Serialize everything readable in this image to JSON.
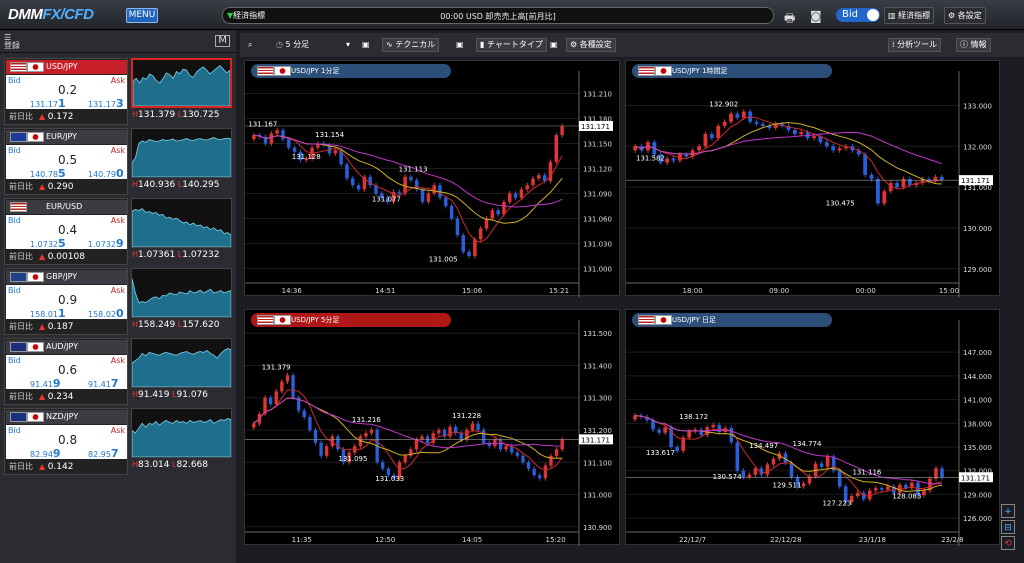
{
  "topbar": {
    "logo_a": "DMM",
    "logo_b": "FX/CFD",
    "menu": "MENU",
    "ticker_tag": "経済指標",
    "ticker_msg": "00:00 USD 卸売売上高[前月比]",
    "bid": "Bid",
    "econ_btn": "経済指標",
    "settings_btn": "各設定"
  },
  "sidebar": {
    "register": "登録",
    "prev_label": "前日比",
    "pairs": [
      {
        "name": "USD/JPY",
        "flags": [
          "us",
          "jp"
        ],
        "spread": "0.2",
        "bid_a": "131.17",
        "bid_b": "1",
        "ask_a": "131.17",
        "ask_b": "3",
        "change": "0.172",
        "high": "131.379",
        "low": "130.725",
        "dir": "up",
        "spark": [
          0.55,
          0.6,
          0.5,
          0.62,
          0.58,
          0.7,
          0.65,
          0.55,
          0.5,
          0.6,
          0.72,
          0.68,
          0.6,
          0.75,
          0.7,
          0.8,
          0.78,
          0.66,
          0.62,
          0.74,
          0.8,
          0.85,
          0.78,
          0.7,
          0.76,
          0.82,
          0.88,
          0.8,
          0.72,
          0.78
        ]
      },
      {
        "name": "EUR/JPY",
        "flags": [
          "eu",
          "jp"
        ],
        "spread": "0.5",
        "bid_a": "140.78",
        "bid_b": "5",
        "ask_a": "140.79",
        "ask_b": "0",
        "change": "0.290",
        "high": "140.936",
        "low": "140.295",
        "dir": "up",
        "spark": [
          0.3,
          0.4,
          0.7,
          0.75,
          0.72,
          0.78,
          0.76,
          0.74,
          0.75,
          0.78,
          0.76,
          0.77,
          0.79,
          0.75,
          0.76,
          0.78,
          0.8,
          0.77,
          0.76,
          0.79,
          0.8,
          0.78,
          0.77,
          0.8,
          0.82,
          0.79,
          0.78,
          0.8,
          0.81,
          0.79
        ]
      },
      {
        "name": "EUR/USD",
        "flags": [
          "eu",
          "us"
        ],
        "spread": "0.4",
        "bid_a": "1.0732",
        "bid_b": "5",
        "ask_a": "1.0732",
        "ask_b": "9",
        "change": "0.00108",
        "high": "1.07361",
        "low": "1.07232",
        "dir": "up",
        "spark": [
          0.75,
          0.78,
          0.76,
          0.8,
          0.72,
          0.74,
          0.7,
          0.72,
          0.66,
          0.68,
          0.6,
          0.62,
          0.58,
          0.6,
          0.55,
          0.5,
          0.52,
          0.46,
          0.5,
          0.44,
          0.46,
          0.4,
          0.42,
          0.36,
          0.4,
          0.34,
          0.36,
          0.28,
          0.3,
          0.25
        ]
      },
      {
        "name": "GBP/JPY",
        "flags": [
          "gb",
          "jp"
        ],
        "spread": "0.9",
        "bid_a": "158.01",
        "bid_b": "1",
        "ask_a": "158.02",
        "ask_b": "0",
        "change": "0.187",
        "high": "158.249",
        "low": "157.620",
        "dir": "up",
        "spark": [
          0.8,
          0.5,
          0.3,
          0.32,
          0.3,
          0.35,
          0.4,
          0.42,
          0.38,
          0.45,
          0.44,
          0.5,
          0.48,
          0.46,
          0.52,
          0.5,
          0.48,
          0.55,
          0.5,
          0.52,
          0.56,
          0.5,
          0.54,
          0.58,
          0.5,
          0.52,
          0.55,
          0.5,
          0.53,
          0.55
        ]
      },
      {
        "name": "AUD/JPY",
        "flags": [
          "au",
          "jp"
        ],
        "spread": "0.6",
        "bid_a": "91.41",
        "bid_b": "9",
        "ask_a": "91.41",
        "ask_b": "7",
        "change": "0.234",
        "high": "91.419",
        "low": "91.076",
        "dir": "up",
        "spark": [
          0.5,
          0.55,
          0.6,
          0.7,
          0.65,
          0.72,
          0.7,
          0.68,
          0.66,
          0.7,
          0.72,
          0.7,
          0.68,
          0.66,
          0.7,
          0.72,
          0.74,
          0.7,
          0.68,
          0.72,
          0.74,
          0.72,
          0.76,
          0.7,
          0.66,
          0.6,
          0.7,
          0.76,
          0.8,
          0.78
        ]
      },
      {
        "name": "NZD/JPY",
        "flags": [
          "nz",
          "jp"
        ],
        "spread": "0.8",
        "bid_a": "82.94",
        "bid_b": "9",
        "ask_a": "82.95",
        "ask_b": "7",
        "change": "0.142",
        "high": "83.014",
        "low": "82.668",
        "dir": "up",
        "spark": [
          0.55,
          0.5,
          0.6,
          0.7,
          0.62,
          0.7,
          0.68,
          0.74,
          0.66,
          0.72,
          0.76,
          0.72,
          0.7,
          0.76,
          0.72,
          0.74,
          0.7,
          0.76,
          0.72,
          0.74,
          0.76,
          0.72,
          0.74,
          0.78,
          0.7,
          0.74,
          0.78,
          0.76,
          0.8,
          0.78
        ]
      }
    ]
  },
  "toolbar": {
    "period": "5 分足",
    "technical": "テクニカル",
    "chart_type": "チャートタイプ",
    "settings": "各種設定",
    "analysis": "分析ツール",
    "info": "情報"
  },
  "colors": {
    "up": "#e03535",
    "down": "#2a5fd8",
    "ma_fast": "#cc2b2b",
    "ma_mid": "#d1b020",
    "ma_slow": "#c038c8",
    "accent": "#2166c8"
  },
  "chart_data": [
    {
      "type": "candlestick",
      "title": "USD/JPY 1分足",
      "ylim": [
        130.985,
        131.225
      ],
      "yticks": [
        "131.210",
        "131.180",
        "131.150",
        "131.120",
        "131.090",
        "131.060",
        "131.030",
        "131.000"
      ],
      "yvals": [
        131.21,
        131.18,
        131.15,
        131.12,
        131.09,
        131.06,
        131.03,
        131.0
      ],
      "xticks": [
        "14:36",
        "14:51",
        "15:06",
        "15:21"
      ],
      "xpos": [
        0.14,
        0.42,
        0.68,
        0.94
      ],
      "current": "131.171",
      "current_val": 131.171,
      "annotations": [
        {
          "t": "131.167",
          "x": 0.01,
          "v": 131.167
        },
        {
          "t": "131.154",
          "x": 0.21,
          "v": 131.154
        },
        {
          "t": "131.128",
          "x": 0.14,
          "v": 131.128
        },
        {
          "t": "131.113",
          "x": 0.46,
          "v": 131.113
        },
        {
          "t": "131.077",
          "x": 0.38,
          "v": 131.077
        },
        {
          "t": "131.005",
          "x": 0.55,
          "v": 131.005
        }
      ],
      "closes": [
        131.16,
        131.158,
        131.15,
        131.162,
        131.166,
        131.155,
        131.145,
        131.14,
        131.13,
        131.132,
        131.145,
        131.15,
        131.148,
        131.138,
        131.142,
        131.125,
        131.108,
        131.1,
        131.095,
        131.11,
        131.1,
        131.09,
        131.085,
        131.08,
        131.092,
        131.09,
        131.11,
        131.106,
        131.095,
        131.08,
        131.09,
        131.1,
        131.085,
        131.075,
        131.06,
        131.04,
        131.02,
        131.015,
        131.035,
        131.048,
        131.06,
        131.07,
        131.065,
        131.08,
        131.09,
        131.085,
        131.095,
        131.1,
        131.108,
        131.112,
        131.105,
        131.128,
        131.16,
        131.171
      ]
    },
    {
      "type": "candlestick",
      "title": "USD/JPY 1時間足",
      "ylim": [
        128.7,
        133.6
      ],
      "yticks": [
        "133.000",
        "132.000",
        "131.000",
        "130.000",
        "129.000"
      ],
      "yvals": [
        133,
        132,
        131,
        130,
        129
      ],
      "xticks": [
        "18:00",
        "09:00",
        "00:00",
        "15:00"
      ],
      "xpos": [
        0.2,
        0.46,
        0.72,
        0.97
      ],
      "current": "131.171",
      "current_val": 131.171,
      "annotations": [
        {
          "t": "132.902",
          "x": 0.25,
          "v": 132.902
        },
        {
          "t": "131.582",
          "x": 0.03,
          "v": 131.582
        },
        {
          "t": "130.475",
          "x": 0.6,
          "v": 130.475
        }
      ],
      "closes": [
        132.0,
        131.9,
        132.1,
        131.8,
        131.6,
        131.7,
        131.65,
        131.8,
        131.75,
        131.9,
        132.0,
        132.3,
        132.2,
        132.5,
        132.6,
        132.8,
        132.7,
        132.85,
        132.6,
        132.55,
        132.5,
        132.45,
        132.55,
        132.5,
        132.4,
        132.3,
        132.35,
        132.2,
        132.25,
        132.1,
        132.0,
        131.9,
        131.95,
        132.0,
        131.9,
        131.8,
        131.3,
        131.2,
        130.6,
        130.9,
        131.1,
        131.0,
        131.2,
        131.05,
        131.1,
        131.2,
        131.15,
        131.25,
        131.17
      ]
    },
    {
      "type": "candlestick",
      "title": "USD/JPY 5分足",
      "ylim": [
        130.89,
        131.51
      ],
      "yticks": [
        "131.500",
        "131.400",
        "131.300",
        "131.200",
        "131.100",
        "131.000",
        "130.900"
      ],
      "yvals": [
        131.5,
        131.4,
        131.3,
        131.2,
        131.1,
        131.0,
        130.9
      ],
      "xticks": [
        "11:35",
        "12:50",
        "14:05",
        "15:20"
      ],
      "xpos": [
        0.17,
        0.42,
        0.68,
        0.93
      ],
      "current": "131.171",
      "current_val": 131.171,
      "annotations": [
        {
          "t": "131.379",
          "x": 0.05,
          "v": 131.379
        },
        {
          "t": "131.216",
          "x": 0.32,
          "v": 131.216
        },
        {
          "t": "131.228",
          "x": 0.62,
          "v": 131.228
        },
        {
          "t": "131.095",
          "x": 0.28,
          "v": 131.095
        },
        {
          "t": "131.033",
          "x": 0.39,
          "v": 131.033
        }
      ],
      "closes": [
        131.22,
        131.25,
        131.3,
        131.28,
        131.32,
        131.35,
        131.37,
        131.3,
        131.26,
        131.24,
        131.2,
        131.16,
        131.12,
        131.15,
        131.18,
        131.14,
        131.1,
        131.13,
        131.15,
        131.18,
        131.19,
        131.2,
        131.1,
        131.08,
        131.06,
        131.05,
        131.1,
        131.12,
        131.14,
        131.17,
        131.18,
        131.16,
        131.19,
        131.2,
        131.18,
        131.21,
        131.19,
        131.17,
        131.2,
        131.22,
        131.2,
        131.16,
        131.15,
        131.17,
        131.14,
        131.15,
        131.13,
        131.12,
        131.1,
        131.08,
        131.06,
        131.05,
        131.09,
        131.12,
        131.14,
        131.17
      ]
    },
    {
      "type": "candlestick",
      "title": "USD/JPY 日足",
      "ylim": [
        124.5,
        149.8
      ],
      "yticks": [
        "147.000",
        "144.000",
        "141.000",
        "138.000",
        "135.000",
        "132.000",
        "129.000",
        "126.000"
      ],
      "yvals": [
        147,
        144,
        141,
        138,
        135,
        132,
        129,
        126
      ],
      "xticks": [
        "22/12/7",
        "22/12/28",
        "23/1/18",
        "23/2/8"
      ],
      "xpos": [
        0.2,
        0.48,
        0.74,
        0.98
      ],
      "current": "131.171",
      "current_val": 131.171,
      "annotations": [
        {
          "t": "138.172",
          "x": 0.16,
          "v": 138.172
        },
        {
          "t": "133.617",
          "x": 0.06,
          "v": 133.617
        },
        {
          "t": "134.497",
          "x": 0.37,
          "v": 134.497
        },
        {
          "t": "134.774",
          "x": 0.5,
          "v": 134.774
        },
        {
          "t": "130.574",
          "x": 0.26,
          "v": 130.574
        },
        {
          "t": "129.511",
          "x": 0.44,
          "v": 129.511
        },
        {
          "t": "131.116",
          "x": 0.68,
          "v": 131.116
        },
        {
          "t": "127.223",
          "x": 0.59,
          "v": 127.223
        },
        {
          "t": "128.083",
          "x": 0.8,
          "v": 128.083
        }
      ],
      "closes": [
        139.0,
        138.8,
        138.4,
        137.2,
        136.8,
        137.5,
        135.0,
        134.5,
        136.2,
        137.0,
        137.2,
        136.5,
        137.5,
        137.8,
        136.9,
        137.4,
        135.6,
        132.0,
        131.2,
        131.5,
        132.3,
        131.5,
        132.8,
        133.5,
        134.2,
        133.0,
        131.2,
        130.0,
        130.4,
        131.3,
        132.9,
        132.5,
        133.8,
        132.0,
        130.0,
        128.0,
        128.8,
        129.2,
        128.4,
        129.5,
        129.8,
        129.6,
        130.0,
        129.2,
        130.2,
        129.8,
        130.5,
        128.9,
        129.5,
        131.0,
        132.3,
        131.17
      ]
    }
  ]
}
